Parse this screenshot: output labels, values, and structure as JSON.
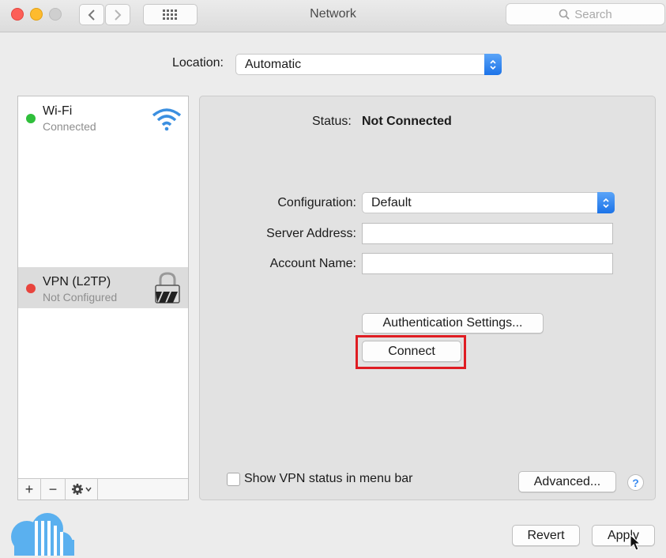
{
  "window": {
    "title": "Network",
    "search_placeholder": "Search"
  },
  "location": {
    "label": "Location:",
    "value": "Automatic"
  },
  "sidebar": {
    "services": [
      {
        "name": "Wi-Fi",
        "status": "Connected",
        "status_color": "#2fbf3b",
        "icon": "wifi-icon"
      },
      {
        "name": "VPN (L2TP)",
        "status": "Not Configured",
        "status_color": "#e8443d",
        "icon": "lock-icon",
        "selected": true
      }
    ],
    "toolbar": {
      "add": "+",
      "remove": "−"
    }
  },
  "main": {
    "status_label": "Status:",
    "status_value": "Not Connected",
    "configuration": {
      "label": "Configuration:",
      "value": "Default"
    },
    "server_address": {
      "label": "Server Address:",
      "value": ""
    },
    "account_name": {
      "label": "Account Name:",
      "value": ""
    },
    "auth_button": "Authentication Settings...",
    "connect_button": "Connect",
    "show_vpn_status": {
      "label": "Show VPN status in menu bar",
      "checked": false
    },
    "advanced_button": "Advanced...",
    "help": "?"
  },
  "footer": {
    "revert_button": "Revert",
    "apply_button": "Apply"
  },
  "colors": {
    "accent_blue": "#1c73e8",
    "highlight_red": "#df1c22",
    "logo_blue": "#5ab0ef"
  }
}
